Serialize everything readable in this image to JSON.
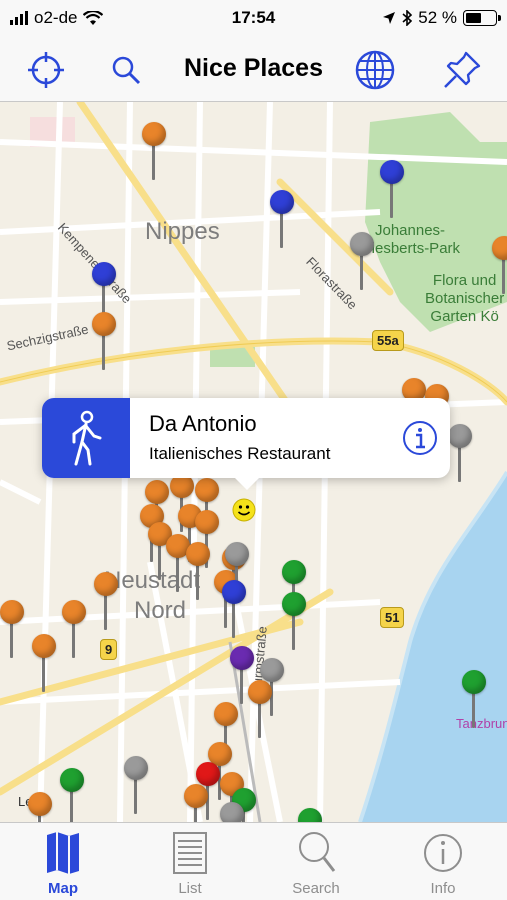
{
  "status_bar": {
    "carrier": "o2-de",
    "time": "17:54",
    "battery_percent": "52 %",
    "battery_level": 0.52
  },
  "nav": {
    "title": "Nice Places",
    "left_icons": [
      "crosshair-icon",
      "search-icon"
    ],
    "right_icons": [
      "globe-icon",
      "pushpin-icon"
    ],
    "accent_color": "#2b49d9"
  },
  "map": {
    "districts": [
      "Nippes",
      "Neustadt",
      "Nord"
    ],
    "streets": [
      "Kempener Straße",
      "Sechzigstraße",
      "Florastraße",
      "Turmstraße"
    ],
    "parks": [
      "Johannes-\nGiesberts-Park",
      "Flora und\nBotanischer\nGarten Kö"
    ],
    "road_shields": [
      "55a",
      "51",
      "9"
    ],
    "poi": "Tanzbrunnen",
    "legal": "Legal",
    "pin_colors": {
      "orange": "#e8842a",
      "blue": "#2f3fd6",
      "green": "#1fa030",
      "grey": "#9a9a9a",
      "purple": "#6a2bb0",
      "red": "#e01818"
    }
  },
  "callout": {
    "title": "Da Antonio",
    "subtitle": "Italienisches Restaurant",
    "left_icon": "walking-person-icon",
    "right_icon": "info-icon"
  },
  "tabs": [
    {
      "label": "Map",
      "icon": "map-icon",
      "active": true
    },
    {
      "label": "List",
      "icon": "list-icon",
      "active": false
    },
    {
      "label": "Search",
      "icon": "magnifier-icon",
      "active": false
    },
    {
      "label": "Info",
      "icon": "info-icon",
      "active": false
    }
  ]
}
